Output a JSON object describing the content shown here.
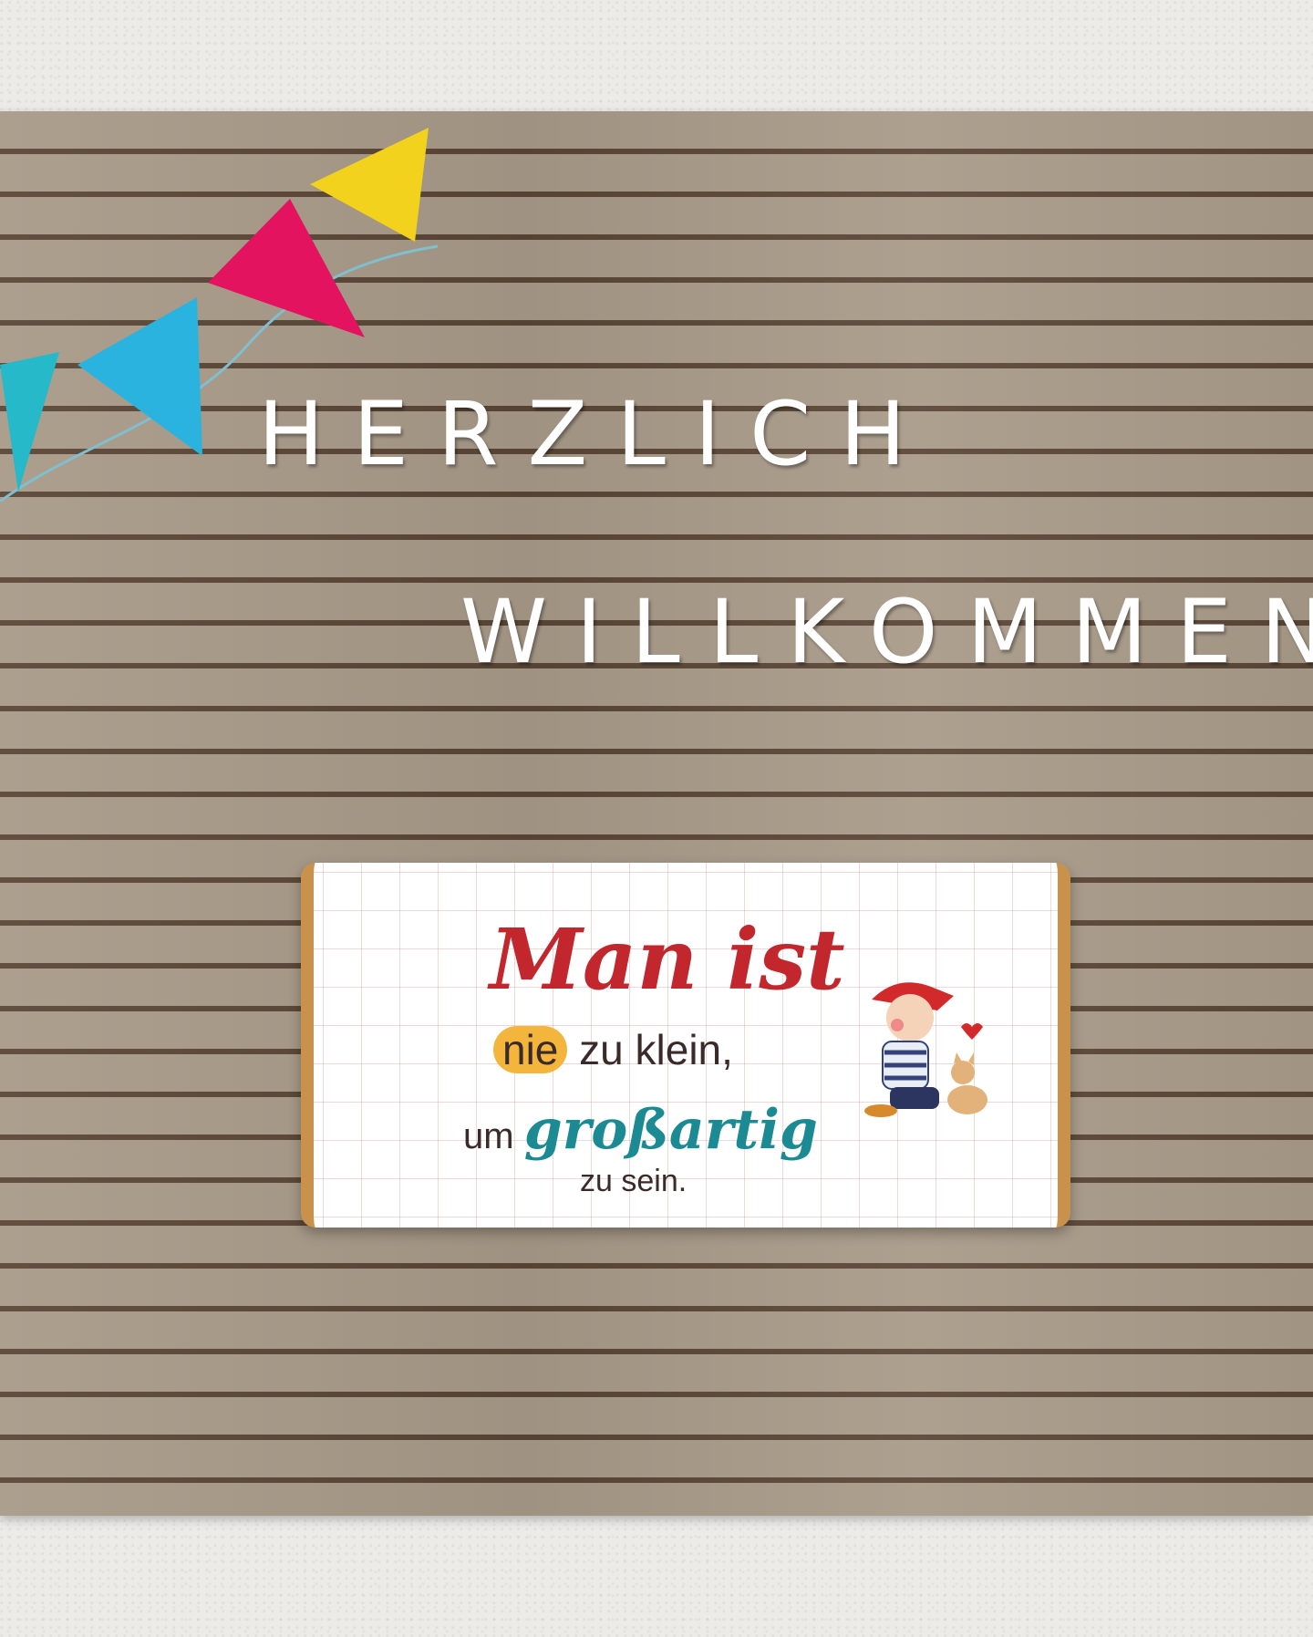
{
  "board": {
    "line1": "HERZLICH",
    "line2": "WILLKOMMEN"
  },
  "card": {
    "line1": "Man ist",
    "highlight": "nie",
    "line2_rest": "zu klein,",
    "line3_prefix": "um",
    "line3_word": "großartig",
    "line4": "zu sein."
  },
  "colors": {
    "flag_yellow": "#f2d21c",
    "flag_pink": "#e3135f",
    "flag_blue": "#2bb3e0",
    "flag_teal": "#25b9c9",
    "quote_red": "#c1272d",
    "quote_teal": "#1b8a93",
    "highlight_yellow": "#f3b53c"
  }
}
